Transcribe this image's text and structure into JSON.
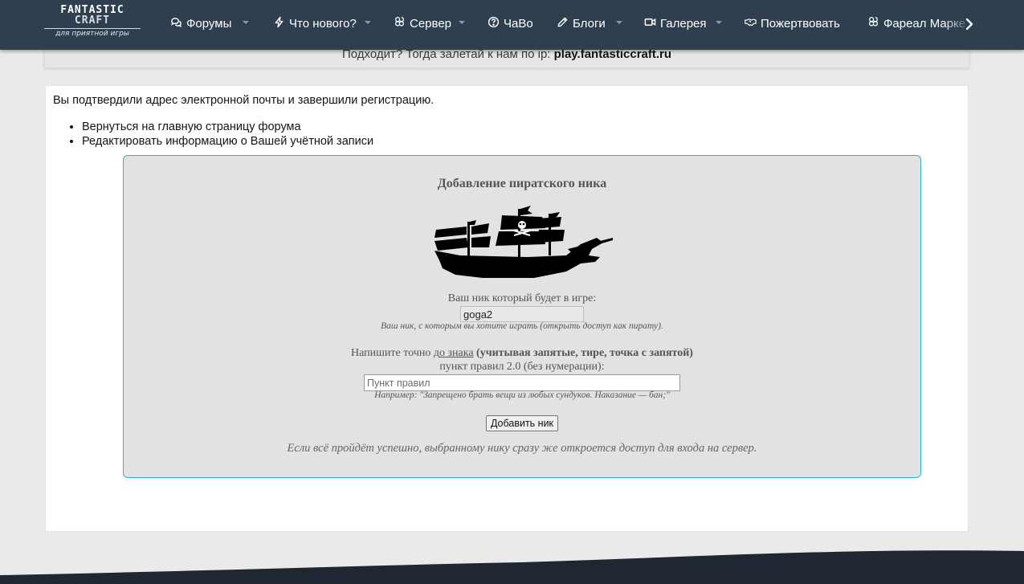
{
  "site": {
    "logo_line1": "FANTASTIC",
    "logo_line2": "CRAFT",
    "logo_tagline": "для приятной игры"
  },
  "nav": {
    "items": [
      {
        "label": "Форумы",
        "icon": "comments-icon",
        "has_dropdown": true
      },
      {
        "label": "Что нового?",
        "icon": "bolt-icon",
        "has_dropdown": true
      },
      {
        "label": "Сервер",
        "icon": "cubes-icon",
        "has_dropdown": true
      },
      {
        "label": "ЧаВо",
        "icon": "question-circle-icon",
        "has_dropdown": false
      },
      {
        "label": "Блоги",
        "icon": "pencil-icon",
        "has_dropdown": true
      },
      {
        "label": "Галерея",
        "icon": "video-icon",
        "has_dropdown": true
      },
      {
        "label": "Пожертвовать",
        "icon": "handshake-icon",
        "has_dropdown": false
      },
      {
        "label": "Фареал Марке",
        "icon": "cubes-icon",
        "has_dropdown": false
      }
    ],
    "more_icon": "chevron-right-icon",
    "bg_color": "#2f3f4f"
  },
  "notice": {
    "text": "Подходит? Тогда залетай к нам по ip:",
    "ip": "play.fantasticcraft.ru"
  },
  "main": {
    "confirmation_text": "Вы подтвердили адрес электронной почты и завершили регистрацию.",
    "links": [
      "Вернуться на главную страницу форума",
      "Редактировать информацию о Вашей учётной записи"
    ]
  },
  "pirate_form": {
    "title": "Добавление пиратского ника",
    "image_icon": "pirate-ship-icon",
    "nick_label": "Ваш ник который будет в игре:",
    "nick_value": "goga2",
    "nick_hint": "Ваш ник, с которым вы хотите играть (открыть доступ как пирату).",
    "rule_label_prefix": "Напишите точно д",
    "rule_label_underlined": "о знака",
    "rule_label_bold": " (учитывая запятые, тире, точка с запятой)",
    "rule_label_line2": "пункт правил 2.0 (без нумерации):",
    "rule_placeholder": "Пункт правил",
    "rule_hint": "Например: \"Запрещено брать вещи из любых сундуков. Наказание — бан;\"",
    "submit_label": "Добавить ник",
    "final_note": "Если всё пройдёт успешно, выбранному нику сразу же откроется доступ для входа на сервер.",
    "border_color": "#29b6c6"
  }
}
